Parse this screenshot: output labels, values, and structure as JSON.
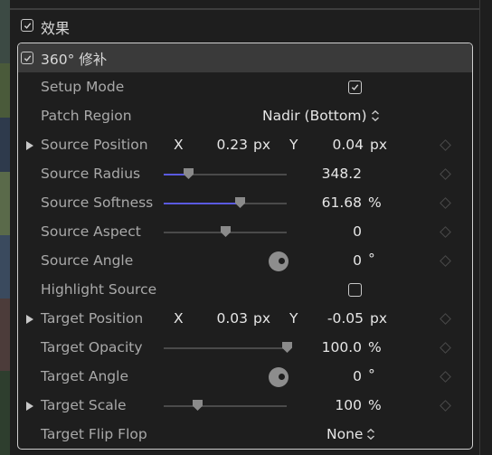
{
  "section": {
    "title": "效果"
  },
  "effect": {
    "title": "360° 修补"
  },
  "rows": {
    "setup_mode": {
      "label": "Setup Mode",
      "checked": true
    },
    "patch_region": {
      "label": "Patch Region",
      "value": "Nadir (Bottom)"
    },
    "source_position": {
      "label": "Source Position",
      "x_label": "X",
      "x_value": "0.23",
      "x_unit": "px",
      "y_label": "Y",
      "y_value": "0.04",
      "y_unit": "px"
    },
    "source_radius": {
      "label": "Source Radius",
      "value": "348.2",
      "slider_fraction": 0.2
    },
    "source_softness": {
      "label": "Source Softness",
      "value": "61.68",
      "unit": "%",
      "slider_fraction": 0.62
    },
    "source_aspect": {
      "label": "Source Aspect",
      "value": "0",
      "slider_fraction": 0.5
    },
    "source_angle": {
      "label": "Source Angle",
      "value": "0",
      "unit": "°"
    },
    "highlight_source": {
      "label": "Highlight Source",
      "checked": false
    },
    "target_position": {
      "label": "Target Position",
      "x_label": "X",
      "x_value": "0.03",
      "x_unit": "px",
      "y_label": "Y",
      "y_value": "-0.05",
      "y_unit": "px"
    },
    "target_opacity": {
      "label": "Target Opacity",
      "value": "100.0",
      "unit": "%",
      "slider_fraction": 1.0
    },
    "target_angle": {
      "label": "Target Angle",
      "value": "0",
      "unit": "°"
    },
    "target_scale": {
      "label": "Target Scale",
      "value": "100",
      "unit": "%",
      "slider_fraction": 0.27
    },
    "target_flip_flop": {
      "label": "Target Flip Flop",
      "value": "None"
    }
  },
  "colors": {
    "slider_fill": "#5a5ae0",
    "panel_border": "#cfcfcf",
    "header_bg": "#3a3a3a"
  }
}
